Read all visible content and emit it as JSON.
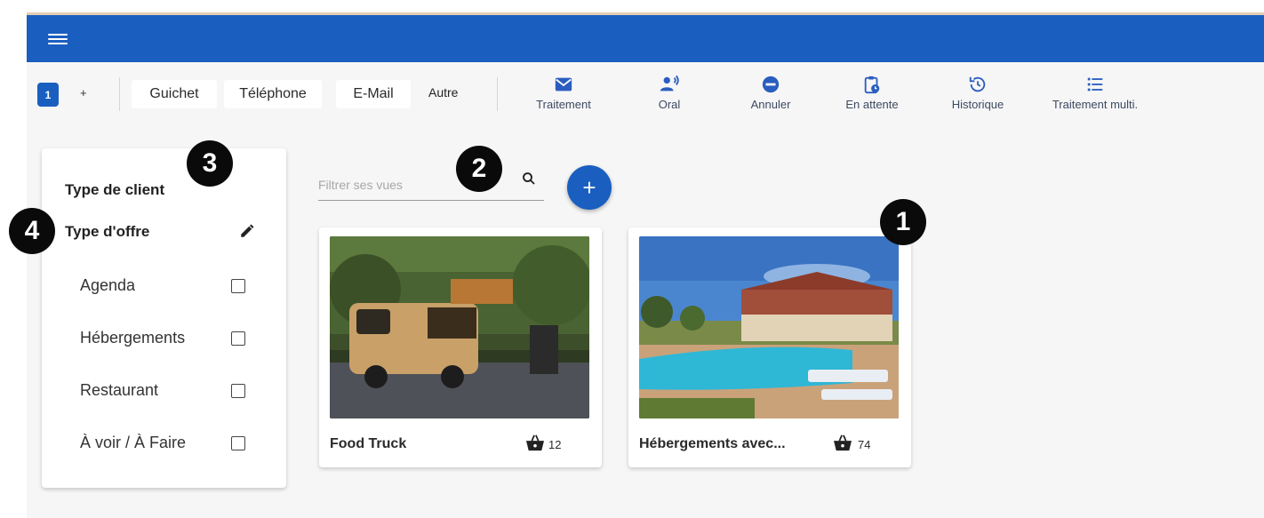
{
  "toolbar": {
    "tab_number": "1",
    "new_tab": "+",
    "channels": [
      "Guichet",
      "Téléphone",
      "E-Mail"
    ],
    "autre": "Autre",
    "actions": [
      {
        "label": "Traitement",
        "icon": "mail-icon"
      },
      {
        "label": "Oral",
        "icon": "speaker-icon"
      },
      {
        "label": "Annuler",
        "icon": "minus-circle-icon"
      },
      {
        "label": "En attente",
        "icon": "clipboard-clock-icon"
      },
      {
        "label": "Historique",
        "icon": "history-icon"
      },
      {
        "label": "Traitement multi.",
        "icon": "list-icon"
      }
    ]
  },
  "sidebar": {
    "title": "Type de client",
    "offer_title": "Type d'offre",
    "edit_icon": "pencil-icon",
    "options": [
      "Agenda",
      "Hébergements",
      "Restaurant",
      "À voir / À Faire"
    ]
  },
  "search": {
    "placeholder": "Filtrer ses vues",
    "icon": "search-icon",
    "add_label": "+"
  },
  "cards": [
    {
      "name": "Food Truck",
      "count": "12",
      "icon": "basket-icon"
    },
    {
      "name": "Hébergements avec...",
      "count": "74",
      "icon": "basket-icon"
    }
  ],
  "badges": [
    "1",
    "2",
    "3",
    "4"
  ],
  "colors": {
    "primary": "#1a5fc0",
    "background": "#f6f6f7",
    "action_icon": "#2b5dbf",
    "badge": "#0a0a0a"
  }
}
